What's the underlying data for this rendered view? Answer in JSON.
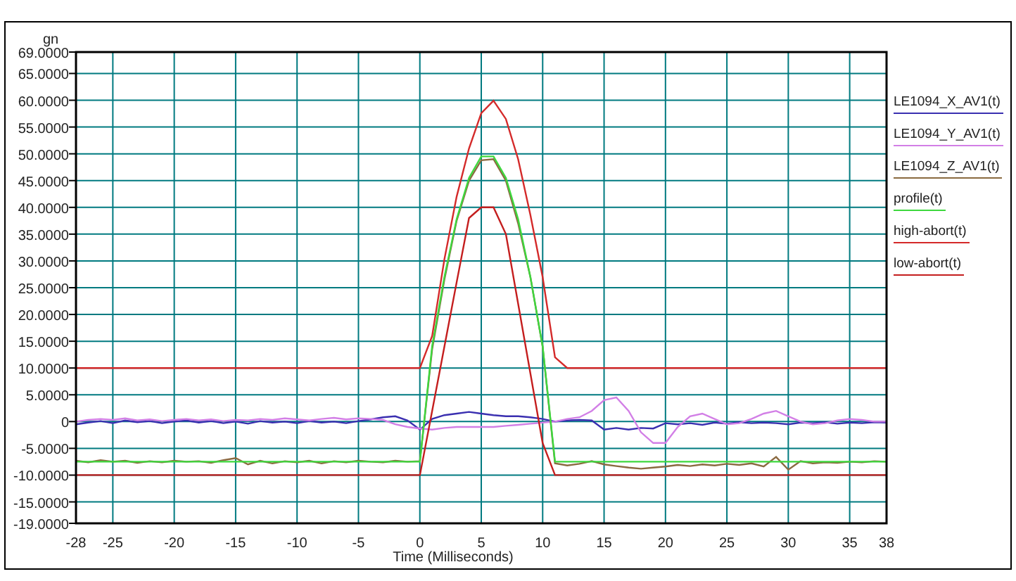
{
  "chart_data": {
    "type": "line",
    "grid": true,
    "xlabel": "Time (Milliseconds)",
    "ylabel": "gn",
    "xlim": [
      -28,
      38
    ],
    "ylim": [
      -19,
      69
    ],
    "xticks": [
      -28,
      -25,
      -20,
      -15,
      -10,
      -5,
      0,
      5,
      10,
      15,
      20,
      25,
      30,
      35,
      38
    ],
    "yticks": [
      {
        "value": 69,
        "label": "69.0000"
      },
      {
        "value": 65,
        "label": "65.0000"
      },
      {
        "value": 60,
        "label": "60.0000"
      },
      {
        "value": 55,
        "label": "55.0000"
      },
      {
        "value": 50,
        "label": "50.0000"
      },
      {
        "value": 45,
        "label": "45.0000"
      },
      {
        "value": 40,
        "label": "40.0000"
      },
      {
        "value": 35,
        "label": "35.0000"
      },
      {
        "value": 30,
        "label": "30.0000"
      },
      {
        "value": 25,
        "label": "25.0000"
      },
      {
        "value": 20,
        "label": "20.0000"
      },
      {
        "value": 15,
        "label": "15.0000"
      },
      {
        "value": 10,
        "label": "10.0000"
      },
      {
        "value": 5,
        "label": "5.0000"
      },
      {
        "value": 0,
        "label": "0"
      },
      {
        "value": -5,
        "label": "-5.0000"
      },
      {
        "value": -10,
        "label": "-10.0000"
      },
      {
        "value": -15,
        "label": "-15.0000"
      },
      {
        "value": -19,
        "label": "-19.0000"
      }
    ],
    "x": [
      -28,
      -27,
      -26,
      -25,
      -24,
      -23,
      -22,
      -21,
      -20,
      -19,
      -18,
      -17,
      -16,
      -15,
      -14,
      -13,
      -12,
      -11,
      -10,
      -9,
      -8,
      -7,
      -6,
      -5,
      -4,
      -3,
      -2,
      -1,
      0,
      1,
      2,
      3,
      4,
      5,
      6,
      7,
      8,
      9,
      10,
      11,
      12,
      13,
      14,
      15,
      16,
      17,
      18,
      19,
      20,
      21,
      22,
      23,
      24,
      25,
      26,
      27,
      28,
      29,
      30,
      31,
      32,
      33,
      34,
      35,
      36,
      37,
      38
    ],
    "series": [
      {
        "name": "LE1094_X_AV1(t)",
        "color": "#3a2fb0",
        "values": [
          -0.5,
          -0.2,
          0.1,
          -0.3,
          0.2,
          -0.1,
          0.1,
          -0.3,
          0,
          0.2,
          -0.2,
          0.1,
          -0.3,
          0,
          -0.4,
          0.1,
          -0.2,
          0,
          -0.3,
          0.1,
          -0.2,
          0,
          -0.3,
          0.1,
          0.4,
          0.8,
          1,
          0.2,
          -1.5,
          0.5,
          1.2,
          1.5,
          1.8,
          1.5,
          1.2,
          1,
          1,
          0.8,
          0.5,
          0,
          0.2,
          0.3,
          0.2,
          -1.5,
          -1.2,
          -1.5,
          -1.2,
          -1.3,
          -0.3,
          -0.5,
          -0.3,
          -0.6,
          -0.2,
          -0.4,
          -0.1,
          -0.3,
          -0.2,
          -0.3,
          -0.5,
          -0.2,
          -0.3,
          -0.1,
          -0.4,
          -0.2,
          -0.3,
          -0.1,
          -0.2
        ]
      },
      {
        "name": "LE1094_Y_AV1(t)",
        "color": "#d27fe6",
        "values": [
          0,
          0.3,
          0.5,
          0.3,
          0.6,
          0.2,
          0.4,
          0.1,
          0.3,
          0.5,
          0.2,
          0.4,
          0.1,
          0.3,
          0.2,
          0.5,
          0.3,
          0.6,
          0.4,
          0.2,
          0.5,
          0.7,
          0.4,
          0.6,
          0.5,
          0.3,
          -0.5,
          -1,
          -1.3,
          -1.5,
          -1.2,
          -1,
          -1,
          -1,
          -1,
          -0.8,
          -0.6,
          -0.4,
          -0.2,
          0,
          0.5,
          0.8,
          2,
          4,
          4.5,
          2,
          -2,
          -4,
          -4,
          -1,
          1,
          1.5,
          0.5,
          -0.5,
          -0.3,
          0.5,
          1.5,
          2,
          1,
          0,
          -0.5,
          -0.3,
          0.2,
          0.5,
          0.3,
          0,
          0
        ]
      },
      {
        "name": "LE1094_Z_AV1(t)",
        "color": "#8a6a40",
        "values": [
          -7.3,
          -7.6,
          -7.2,
          -7.5,
          -7.3,
          -7.7,
          -7.4,
          -7.6,
          -7.3,
          -7.5,
          -7.4,
          -7.7,
          -7.2,
          -6.8,
          -8,
          -7.3,
          -7.8,
          -7.4,
          -7.6,
          -7.3,
          -7.8,
          -7.4,
          -7.6,
          -7.3,
          -7.5,
          -7.6,
          -7.3,
          -7.5,
          -7.4,
          13.5,
          26.5,
          37.5,
          45,
          48.8,
          49,
          45,
          37,
          27,
          14,
          -7.8,
          -8.2,
          -7.9,
          -7.4,
          -8,
          -8.3,
          -8.6,
          -8.8,
          -8.6,
          -8.4,
          -8.1,
          -8.3,
          -8,
          -8.2,
          -7.9,
          -8.1,
          -7.8,
          -8.4,
          -6.6,
          -9,
          -7.4,
          -7.8,
          -7.6,
          -7.7,
          -7.5,
          -7.6,
          -7.4,
          -7.5
        ]
      },
      {
        "name": "profile(t)",
        "color": "#3ed83e",
        "values": [
          -7.5,
          -7.5,
          -7.5,
          -7.5,
          -7.5,
          -7.5,
          -7.5,
          -7.5,
          -7.5,
          -7.5,
          -7.5,
          -7.5,
          -7.5,
          -7.5,
          -7.5,
          -7.5,
          -7.5,
          -7.5,
          -7.5,
          -7.5,
          -7.5,
          -7.5,
          -7.5,
          -7.5,
          -7.5,
          -7.5,
          -7.5,
          -7.5,
          -7.5,
          14.1,
          27,
          37.8,
          45.5,
          49.5,
          49.5,
          45.5,
          37.8,
          27,
          14.1,
          -7.5,
          -7.5,
          -7.5,
          -7.5,
          -7.5,
          -7.5,
          -7.5,
          -7.5,
          -7.5,
          -7.5,
          -7.5,
          -7.5,
          -7.5,
          -7.5,
          -7.5,
          -7.5,
          -7.5,
          -7.5,
          -7.5,
          -7.5,
          -7.5,
          -7.5,
          -7.5,
          -7.5,
          -7.5,
          -7.5,
          -7.5,
          -7.5
        ]
      },
      {
        "name": "high-abort(t)",
        "color": "#d42a2a",
        "values": [
          10,
          10,
          10,
          10,
          10,
          10,
          10,
          10,
          10,
          10,
          10,
          10,
          10,
          10,
          10,
          10,
          10,
          10,
          10,
          10,
          10,
          10,
          10,
          10,
          10,
          10,
          10,
          10,
          10,
          16,
          30.3,
          42,
          51,
          57.6,
          59.9,
          56.5,
          49,
          38.6,
          27,
          12,
          10,
          10,
          10,
          10,
          10,
          10,
          10,
          10,
          10,
          10,
          10,
          10,
          10,
          10,
          10,
          10,
          10,
          10,
          10,
          10,
          10,
          10,
          10,
          10,
          10,
          10,
          10
        ]
      },
      {
        "name": "low-abort(t)",
        "color": "#c41e1e",
        "values": [
          -10,
          -10,
          -10,
          -10,
          -10,
          -10,
          -10,
          -10,
          -10,
          -10,
          -10,
          -10,
          -10,
          -10,
          -10,
          -10,
          -10,
          -10,
          -10,
          -10,
          -10,
          -10,
          -10,
          -10,
          -10,
          -10,
          -10,
          -10,
          -10,
          2,
          14,
          26,
          38,
          40,
          40,
          35,
          22,
          9,
          -4,
          -10,
          -10,
          -10,
          -10,
          -10,
          -10,
          -10,
          -10,
          -10,
          -10,
          -10,
          -10,
          -10,
          -10,
          -10,
          -10,
          -10,
          -10,
          -10,
          -10,
          -10,
          -10,
          -10,
          -10,
          -10,
          -10,
          -10,
          -10
        ]
      }
    ]
  }
}
